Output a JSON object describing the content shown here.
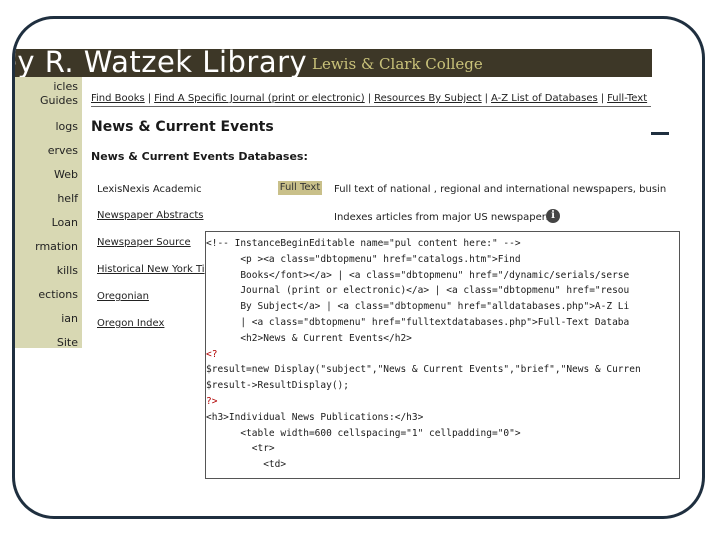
{
  "banner": {
    "title": "ey R. Watzek Library",
    "college": "Lewis & Clark College"
  },
  "sidebar": {
    "items": [
      "icles",
      "Guides",
      "logs",
      "erves",
      "Web",
      "helf",
      "Loan",
      "rmation",
      "kills",
      "ections",
      "ian",
      "Site"
    ]
  },
  "nav": {
    "items": [
      "Find Books",
      "Find A Specific Journal (print or electronic)",
      "Resources By Subject",
      "A-Z List of Databases",
      "Full-Text"
    ],
    "separator": "|"
  },
  "page": {
    "heading": "News & Current Events",
    "subheading": "News & Current Events Databases:"
  },
  "databases": [
    {
      "name": "LexisNexis Academic",
      "badge": "Full Text",
      "desc": "Full text of national , regional and international newspapers, busin"
    },
    {
      "name": "Newspaper Abstracts",
      "desc": "Indexes articles from major US newspapers."
    },
    {
      "name": "Newspaper Source"
    },
    {
      "name": "Historical New York Ti"
    },
    {
      "name": "Oregonian"
    },
    {
      "name": "Oregon Index"
    }
  ],
  "code": {
    "lines": [
      "<!-- InstanceBeginEditable name=\"pul content here:\" -->",
      "      <p ><a class=\"dbtopmenu\" href=\"catalogs.htm\">Find",
      "      Books</font></a> | <a class=\"dbtopmenu\" href=\"/dynamic/serials/serse",
      "      Journal (print or electronic)</a> | <a class=\"dbtopmenu\" href=\"resou",
      "      By Subject</a> | <a class=\"dbtopmenu\" href=\"alldatabases.php\">A-Z Li",
      "      | <a class=\"dbtopmenu\" href=\"fulltextdatabases.php\">Full-Text Databa",
      "      <h2>News & Current Events</h2>",
      "<?",
      "$result=new Display(\"subject\",\"News & Current Events\",\"brief\",\"News & Curren",
      "$result->ResultDisplay();",
      "?>",
      "",
      "<h3>Individual News Publications:</h3>",
      "      <table width=600 cellspacing=\"1\" cellpadding=\"0\">",
      "        <tr>",
      "          <td>"
    ]
  }
}
